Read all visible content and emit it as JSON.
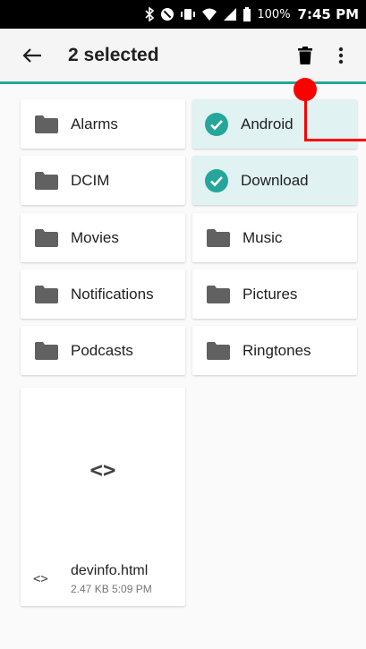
{
  "status_bar": {
    "battery_percent": "100%",
    "time": "7:45 PM"
  },
  "app_bar": {
    "title": "2 selected",
    "icons": [
      "back-arrow-icon",
      "trash-icon",
      "more-vert-icon"
    ]
  },
  "folders": [
    {
      "label": "Alarms",
      "selected": false
    },
    {
      "label": "Android",
      "selected": true
    },
    {
      "label": "DCIM",
      "selected": false
    },
    {
      "label": "Download",
      "selected": true
    },
    {
      "label": "Movies",
      "selected": false
    },
    {
      "label": "Music",
      "selected": false
    },
    {
      "label": "Notifications",
      "selected": false
    },
    {
      "label": "Pictures",
      "selected": false
    },
    {
      "label": "Podcasts",
      "selected": false
    },
    {
      "label": "Ringtones",
      "selected": false
    }
  ],
  "file": {
    "name": "devinfo.html",
    "meta": "2.47 KB 5:09 PM",
    "preview_glyph": "<>"
  },
  "colors": {
    "accent": "#26a69a",
    "selected_bg": "#e0f2f1",
    "annotation": "#ff0000"
  }
}
